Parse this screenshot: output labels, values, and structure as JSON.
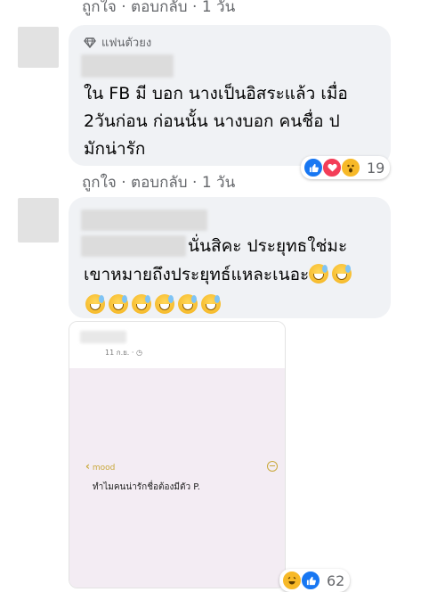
{
  "colors": {
    "like_blue": "#1877f2",
    "love_red": "#f33e58",
    "haha_yellow": "#f7b928",
    "meta_gray": "#65676b",
    "bubble_bg": "#f0f2f5"
  },
  "comment1": {
    "top_meta": "ถูกใจ · ตอบกลับ · 1 วัน",
    "badge": "แฟนตัวยง",
    "badge_icon": "diamond-icon",
    "text": "ใน FB มี บอก นางเป็นอิสระแล้ว เมื่อ\n2วันก่อน ก่อนนั้น นางบอก คนชื่อ ป\nมักน่ารัก",
    "reactions": [
      "like",
      "love",
      "wow"
    ],
    "reaction_count": "19",
    "actions": "ถูกใจ · ตอบกลับ · 1 วัน"
  },
  "comment2": {
    "line1": "นั่นสิคะ ประยุทธใช่มะ",
    "line2": "เขาหมายถึงประยุทธ์แหละเนอะ",
    "emoji_name": "grinning-sweat-emoji"
  },
  "attachment": {
    "date": "11 ก.ย. · ",
    "back_label": "mood",
    "question": "ทำไมคนน่ารักชื่อต้องมีตัว P.",
    "reactions": [
      "haha",
      "like"
    ],
    "reaction_count": "62"
  }
}
